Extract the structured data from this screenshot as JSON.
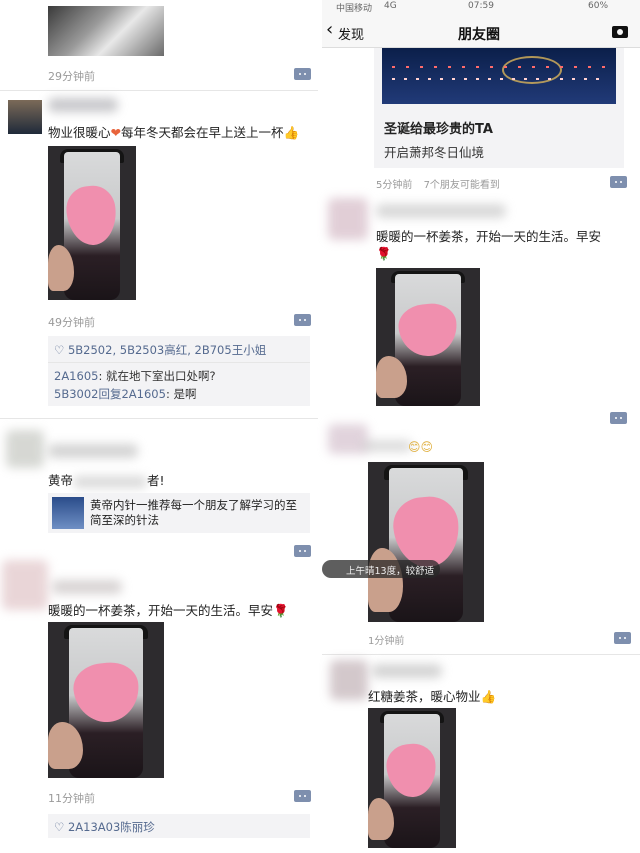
{
  "left": {
    "top_time": "29分钟前",
    "post1": {
      "text": "物业很暖心",
      "text2": "每年冬天都会在早上送上一杯",
      "time": "49分钟前",
      "likes": "5B2502, 5B2503高红, 2B705王小姐",
      "comments": [
        {
          "who": "2A1605",
          "text": ": 就在地下室出口处啊?"
        },
        {
          "who": "5B3002回复2A1605",
          "text": ": 是啊"
        }
      ]
    },
    "post2": {
      "text": "黄帝",
      "text_tail": "者!",
      "share_text": "黄帝内针一推荐每一个朋友了解学习的至简至深的针法"
    },
    "post3": {
      "text": "暖暖的一杯姜茶，开始一天的生活。早安",
      "time": "11分钟前",
      "likes": "2A13A03陈丽珍"
    }
  },
  "right": {
    "status": {
      "carrier": "中国移动",
      "network": "4G",
      "time": "07:59",
      "battery": "60%"
    },
    "nav": {
      "back": "发现",
      "title": "朋友圈"
    },
    "article": {
      "title": "圣诞给最珍贵的TA",
      "subtitle": "开启萧邦冬日仙境"
    },
    "meta": {
      "time": "5分钟前",
      "visibility": "7个朋友可能看到"
    },
    "post1": {
      "text": "暖暖的一杯姜茶，开始一天的生活。早安"
    },
    "post2": {
      "location": "上午晴13度，较舒适",
      "time": "1分钟前"
    },
    "post3": {
      "text": "红糖姜茶，暖心物业"
    }
  },
  "colors": {
    "link": "#556a8f",
    "accent": "#7e8fae",
    "heart": "#f08fae"
  }
}
